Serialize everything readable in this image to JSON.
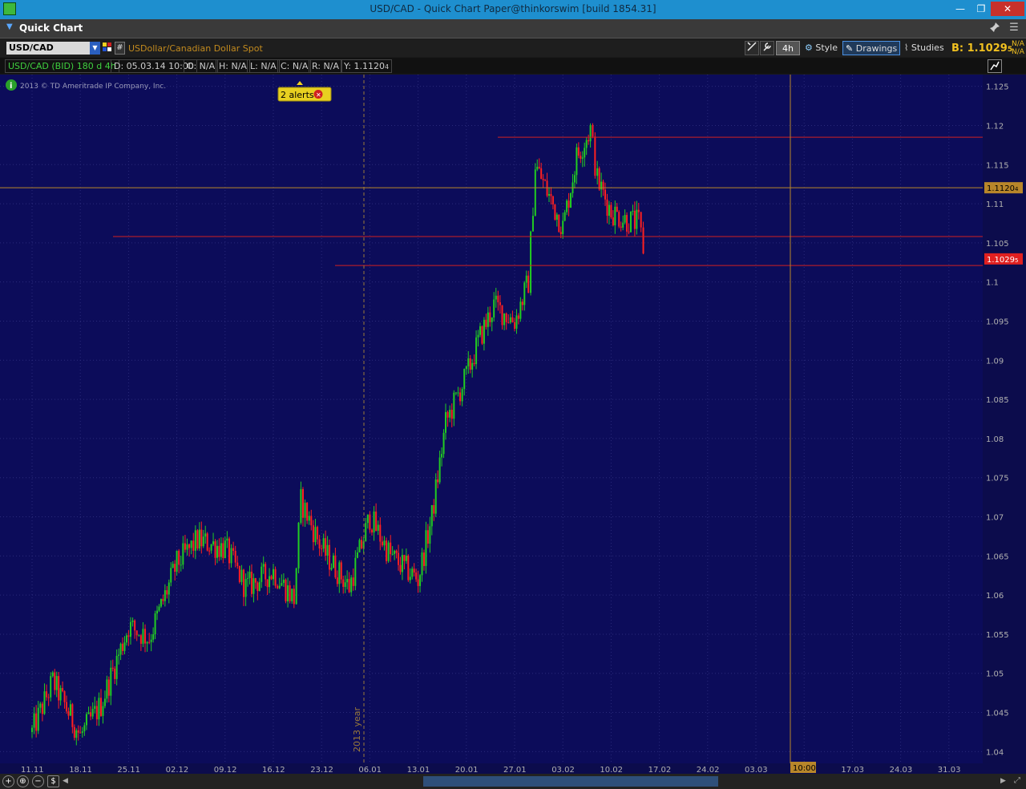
{
  "window": {
    "title": "USD/CAD - Quick Chart Paper@thinkorswim [build 1854.31]",
    "min_glyph": "—",
    "max_glyph": "❐",
    "close_glyph": "✕"
  },
  "header": {
    "label": "Quick Chart",
    "collapse_glyph": "▼",
    "pin_glyph": "📌",
    "menu_glyph": "☰"
  },
  "toolbar": {
    "symbol": "USD/CAD",
    "description": "USDollar/Canadian Dollar Spot",
    "period": "4h",
    "style_label": "Style",
    "drawings_label": "Drawings",
    "studies_label": "Studies",
    "bid_label": "B: 1.1029",
    "bid_sub": "5",
    "na_1": "N/A",
    "na_2": "N/A"
  },
  "info_row": {
    "symbol": "USD/CAD (BID) 180 d 4h",
    "date": "D: 05.03.14 10:00",
    "open": "O: N/A",
    "high": "H: N/A",
    "low": "L: N/A",
    "close": "C: N/A",
    "range": "R: N/A",
    "y": "Y: 1.1120",
    "y_sub": "4"
  },
  "chart_overlay": {
    "copyright": "2013 © TD Ameritrade IP Company, Inc.",
    "alerts": "2 alerts",
    "year_marker": "2013 year",
    "cursor_price": "1.1120",
    "cursor_price_sub": "4",
    "last_price": "1.1029",
    "last_price_sub": "5",
    "cursor_time": "10:00"
  },
  "colors": {
    "background": "#0c0c5a",
    "grid": "#2a2a7a",
    "up_candle": "#22cc22",
    "down_candle": "#ff2020",
    "alert_line": "#d02020",
    "cursor_line": "#b8862a"
  },
  "chart_data": {
    "type": "candlestick",
    "title": "USD/CAD (BID) 180 d 4h",
    "xlabel": "",
    "ylabel": "",
    "x_ticks": [
      "11.11",
      "18.11",
      "25.11",
      "02.12",
      "09.12",
      "16.12",
      "23.12",
      "06.01",
      "13.01",
      "20.01",
      "27.01",
      "03.02",
      "10.02",
      "17.02",
      "24.02",
      "03.03",
      "10.03",
      "17.03",
      "24.03",
      "31.03"
    ],
    "y_ticks": [
      1.04,
      1.045,
      1.05,
      1.055,
      1.06,
      1.065,
      1.07,
      1.075,
      1.08,
      1.085,
      1.09,
      1.095,
      1.1,
      1.105,
      1.11,
      1.115,
      1.12,
      1.125
    ],
    "y_tick_labels": [
      "1.04",
      "1.045",
      "1.05",
      "1.055",
      "1.06",
      "1.065",
      "1.07",
      "1.075",
      "1.08",
      "1.085",
      "1.09",
      "1.095",
      "1.1",
      "1.105",
      "1.11",
      "1.115",
      "1.12",
      "1.125"
    ],
    "ylim": [
      1.0385,
      1.1265
    ],
    "grid": true,
    "closes": [
      [
        "11.11",
        1.0425
      ],
      [
        "14.11",
        1.049
      ],
      [
        "18.11",
        1.042
      ],
      [
        "21.11",
        1.046
      ],
      [
        "25.11",
        1.056
      ],
      [
        "28.11",
        1.0545
      ],
      [
        "02.12",
        1.064
      ],
      [
        "05.12",
        1.067
      ],
      [
        "09.12",
        1.066
      ],
      [
        "12.12",
        1.061
      ],
      [
        "16.12",
        1.063
      ],
      [
        "19.12",
        1.0595
      ],
      [
        "20.12",
        1.072
      ],
      [
        "23.12",
        1.066
      ],
      [
        "27.12",
        1.061
      ],
      [
        "30.12",
        1.07
      ],
      [
        "02.01",
        1.065
      ],
      [
        "06.01",
        1.062
      ],
      [
        "08.01",
        1.07
      ],
      [
        "10.01",
        1.082
      ],
      [
        "13.01",
        1.088
      ],
      [
        "15.01",
        1.093
      ],
      [
        "17.01",
        1.097
      ],
      [
        "20.01",
        1.095
      ],
      [
        "22.01",
        1.1
      ],
      [
        "23.01",
        1.115
      ],
      [
        "27.01",
        1.107
      ],
      [
        "29.01",
        1.116
      ],
      [
        "31.01",
        1.1195
      ],
      [
        "01.02",
        1.113
      ],
      [
        "03.02",
        1.109
      ],
      [
        "05.02",
        1.108
      ],
      [
        "07.02",
        1.1075
      ],
      [
        "08.02",
        1.1029
      ]
    ],
    "horizontal_lines": [
      1.1185,
      1.1058,
      1.1021
    ],
    "cursor": {
      "x": "05.03.14 10:00",
      "y": 1.11204
    },
    "last_price": 1.10295
  }
}
